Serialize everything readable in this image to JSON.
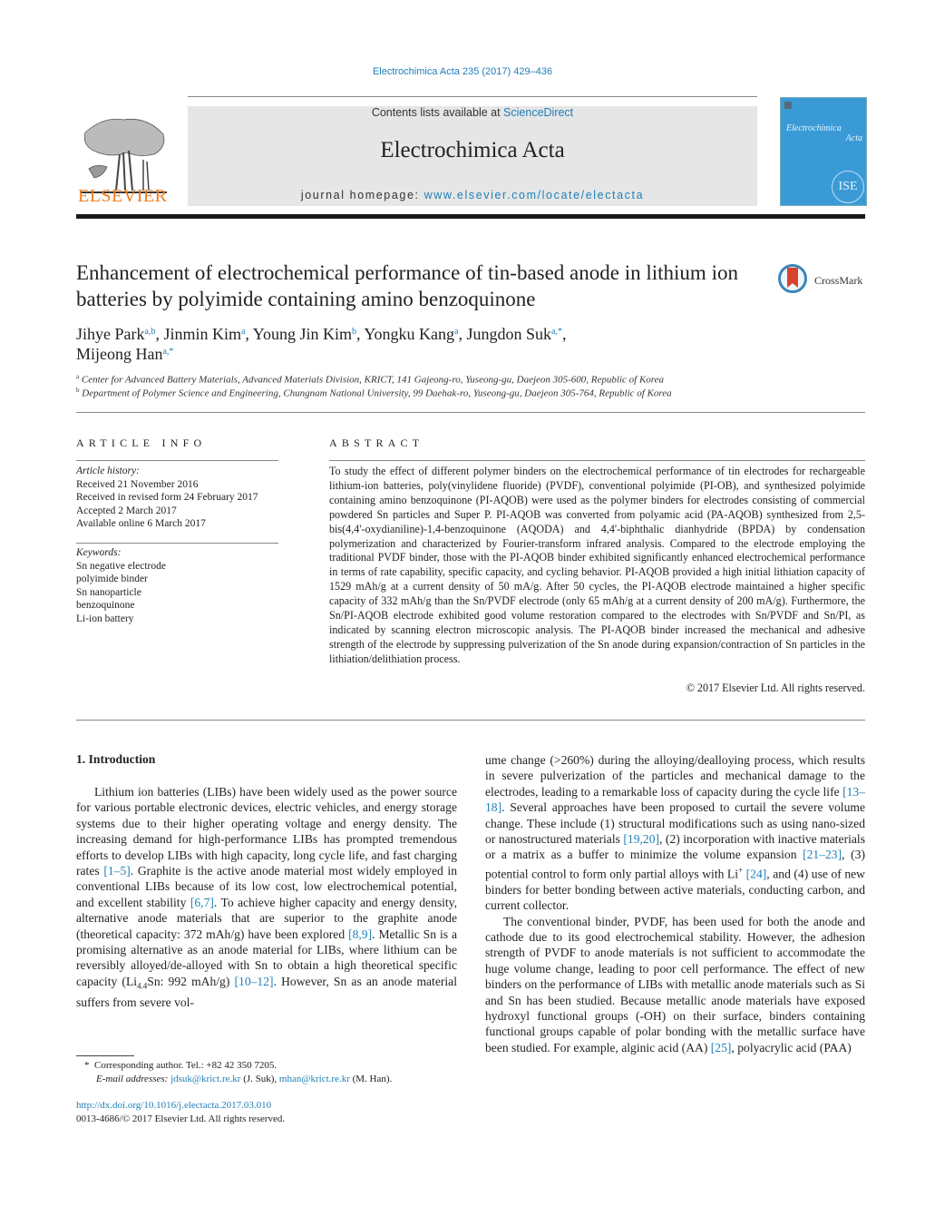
{
  "header": {
    "citation": "Electrochimica Acta 235 (2017) 429–436",
    "contents_prefix": "Contents lists available at ",
    "contents_link": "ScienceDirect",
    "journal_title": "Electrochimica Acta",
    "homepage_prefix": "journal homepage: ",
    "homepage_link": "www.elsevier.com/locate/electacta",
    "publisher_logo_text": "ELSEVIER",
    "cover": {
      "title_line1": "Electrochimica",
      "title_line2": "Acta",
      "badge": "ISE"
    },
    "crossmark_label": "CrossMark",
    "colors": {
      "link": "#1e7fb8",
      "elsevier_orange": "#f07d1d",
      "cover_blue": "#3a9ad6",
      "header_bg": "#e6e6e6"
    }
  },
  "article": {
    "title": "Enhancement of electrochemical performance of tin-based anode in lithium ion batteries by polyimide containing amino benzoquinone",
    "authors": [
      {
        "name": "Jihye Park",
        "sup": "a,b",
        "sep": ", "
      },
      {
        "name": "Jinmin Kim",
        "sup": "a",
        "sep": ", "
      },
      {
        "name": "Young Jin Kim",
        "sup": "b",
        "sep": ", "
      },
      {
        "name": "Yongku Kang",
        "sup": "a",
        "sep": ", "
      },
      {
        "name": "Jungdon Suk",
        "sup": "a,*",
        "sep": ","
      },
      {
        "name": "Mijeong Han",
        "sup": "a,*",
        "sep": ""
      }
    ],
    "affiliations": [
      {
        "mark": "a",
        "text": "Center for Advanced Battery Materials, Advanced Materials Division, KRICT, 141 Gajeong-ro, Yuseong-gu, Daejeon 305-600, Republic of Korea"
      },
      {
        "mark": "b",
        "text": "Department of Polymer Science and Engineering, Chungnam National University, 99 Daehak-ro, Yuseong-gu, Daejeon 305-764, Republic of Korea"
      }
    ]
  },
  "article_info": {
    "heading": "ARTICLE INFO",
    "history_label": "Article history:",
    "history": [
      "Received 21 November 2016",
      "Received in revised form 24 February 2017",
      "Accepted 2 March 2017",
      "Available online 6 March 2017"
    ],
    "keywords_label": "Keywords:",
    "keywords": [
      "Sn negative electrode",
      "polyimide binder",
      "Sn nanoparticle",
      "benzoquinone",
      "Li-ion battery"
    ]
  },
  "abstract": {
    "heading": "ABSTRACT",
    "text": "To study the effect of different polymer binders on the electrochemical performance of tin electrodes for rechargeable lithium-ion batteries, poly(vinylidene fluoride) (PVDF), conventional polyimide (PI-OB), and synthesized polyimide containing amino benzoquinone (PI-AQOB) were used as the polymer binders for electrodes consisting of commercial powdered Sn particles and Super P. PI-AQOB was converted from polyamic acid (PA-AQOB) synthesized from 2,5-bis(4,4'-oxydianiline)-1,4-benzoquinone (AQODA) and 4,4'-biphthalic dianhydride (BPDA) by condensation polymerization and characterized by Fourier-transform infrared analysis. Compared to the electrode employing the traditional PVDF binder, those with the PI-AQOB binder exhibited significantly enhanced electrochemical performance in terms of rate capability, specific capacity, and cycling behavior. PI-AQOB provided a high initial lithiation capacity of 1529 mAh/g at a current density of 50 mA/g. After 50 cycles, the PI-AQOB electrode maintained a higher specific capacity of 332 mAh/g than the Sn/PVDF electrode (only 65 mAh/g at a current density of 200 mA/g). Furthermore, the Sn/PI-AQOB electrode exhibited good volume restoration compared to the electrodes with Sn/PVDF and Sn/PI, as indicated by scanning electron microscopic analysis. The PI-AQOB binder increased the mechanical and adhesive strength of the electrode by suppressing pulverization of the Sn anode during expansion/contraction of Sn particles in the lithiation/delithiation process.",
    "copyright": "© 2017 Elsevier Ltd. All rights reserved."
  },
  "body": {
    "section_heading": "1.  Introduction",
    "left_col": {
      "p1_a": "Lithium ion batteries (LIBs) have been widely used as the power source for various portable electronic devices, electric vehicles, and energy storage systems due to their higher operating voltage and energy density. The increasing demand for high-performance LIBs has prompted tremendous efforts to develop LIBs with high capacity, long cycle life, and fast charging rates ",
      "ref1": "[1–5]",
      "p1_b": ". Graphite is the active anode material most widely employed in conventional LIBs because of its low cost, low electrochemical potential, and excellent stability ",
      "ref2": "[6,7]",
      "p1_c": ". To achieve higher capacity and energy density, alternative anode materials that are superior to the graphite anode (theoretical capacity: 372 mAh/g) have been explored ",
      "ref3": "[8,9]",
      "p1_d": ". Metallic Sn is a promising alternative as an anode material for LIBs, where lithium can be reversibly alloyed/de-alloyed with Sn to obtain a high theoretical specific capacity (Li",
      "li_sub": "4.4",
      "p1_e": "Sn: 992 mAh/g) ",
      "ref4": "[10–12]",
      "p1_f": ". However, Sn as an anode material suffers from severe vol-"
    },
    "right_col": {
      "p1_a": "ume change (>260%) during the alloying/dealloying process, which results in severe pulverization of the particles and mechanical damage to the electrodes, leading to a remarkable loss of capacity during the cycle life ",
      "ref1": "[13–18]",
      "p1_b": ". Several approaches have been proposed to curtail the severe volume change. These include (1) structural modifications such as using nano-sized or nanostructured materials ",
      "ref2": "[19,20]",
      "p1_c": ", (2) incorporation with inactive materials or a matrix as a buffer to minimize the volume expansion ",
      "ref3": "[21–23]",
      "p1_d": ", (3) potential control to form only partial alloys with Li",
      "li_sup": "+",
      "p1_e": " ",
      "ref4": "[24]",
      "p1_f": ", and (4) use of new binders for better bonding between active materials, conducting carbon, and current collector.",
      "p2_a": "The conventional binder, PVDF, has been used for both the anode and cathode due to its good electrochemical stability. However, the adhesion strength of PVDF to anode materials is not sufficient to accommodate the huge volume change, leading to poor cell performance. The effect of new binders on the performance of LIBs with metallic anode materials such as Si and Sn has been studied. Because metallic anode materials have exposed hydroxyl functional groups (-OH) on their surface, binders containing functional groups capable of polar bonding with the metallic surface have been studied. For example, alginic acid (AA) ",
      "ref5": "[25]",
      "p2_b": ", polyacrylic acid (PAA)"
    }
  },
  "footnotes": {
    "star": "*",
    "corresponding": "Corresponding author. Tel.: +82 42 350 7205.",
    "email_label": "E-mail addresses:",
    "email1": "jdsuk@krict.re.kr",
    "email1_name": " (J. Suk), ",
    "email2": "mhan@krict.re.kr",
    "email2_name": " (M. Han).",
    "doi": "http://dx.doi.org/10.1016/j.electacta.2017.03.010",
    "issn": "0013-4686/© 2017 Elsevier Ltd. All rights reserved."
  }
}
